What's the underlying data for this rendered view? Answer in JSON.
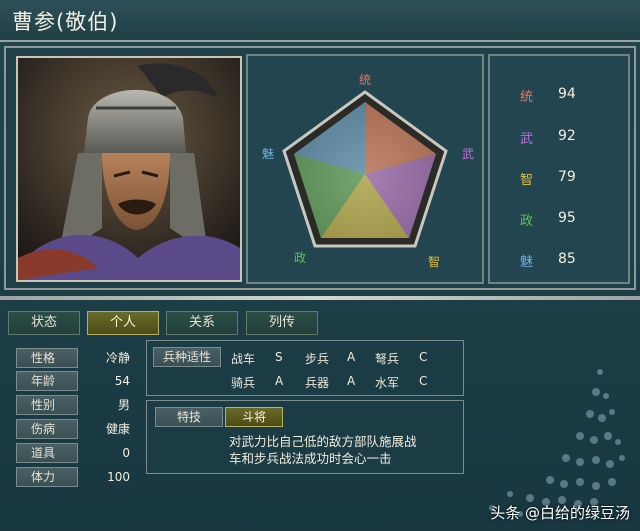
{
  "window": {
    "title": "曹参(敬伯)"
  },
  "radar": {
    "labels": {
      "top": "统",
      "right": "武",
      "bottom_right": "智",
      "bottom_left": "政",
      "left": "魅"
    },
    "label_colors": {
      "top": "#e07a6a",
      "right": "#c070d8",
      "bottom_right": "#e0c040",
      "bottom_left": "#60c060",
      "left": "#70b0e0"
    }
  },
  "stats": [
    {
      "label": "统",
      "value": "94",
      "color": "#e07a6a"
    },
    {
      "label": "武",
      "value": "92",
      "color": "#c070d8"
    },
    {
      "label": "智",
      "value": "79",
      "color": "#e0c040"
    },
    {
      "label": "政",
      "value": "95",
      "color": "#60c060"
    },
    {
      "label": "魅",
      "value": "85",
      "color": "#70b0e0"
    }
  ],
  "tabs": [
    {
      "label": "状态",
      "active": false
    },
    {
      "label": "个人",
      "active": true
    },
    {
      "label": "关系",
      "active": false
    },
    {
      "label": "列传",
      "active": false
    }
  ],
  "info": [
    {
      "label": "性格",
      "value": "冷静"
    },
    {
      "label": "年龄",
      "value": "54"
    },
    {
      "label": "性别",
      "value": "男"
    },
    {
      "label": "伤病",
      "value": "健康"
    },
    {
      "label": "道具",
      "value": "0"
    },
    {
      "label": "体力",
      "value": "100"
    }
  ],
  "troops": {
    "label": "兵种适性",
    "rows": [
      [
        {
          "name": "战车",
          "grade": "S"
        },
        {
          "name": "步兵",
          "grade": "A"
        },
        {
          "name": "弩兵",
          "grade": "C"
        }
      ],
      [
        {
          "name": "骑兵",
          "grade": "A"
        },
        {
          "name": "兵器",
          "grade": "A"
        },
        {
          "name": "水军",
          "grade": "C"
        }
      ]
    ]
  },
  "skill": {
    "label": "特技",
    "name": "斗将",
    "desc_line1": "对武力比自己低的敌方部队施展战",
    "desc_line2": "车和步兵战法成功时会心一击"
  },
  "watermark": "头条 @白给的绿豆汤"
}
